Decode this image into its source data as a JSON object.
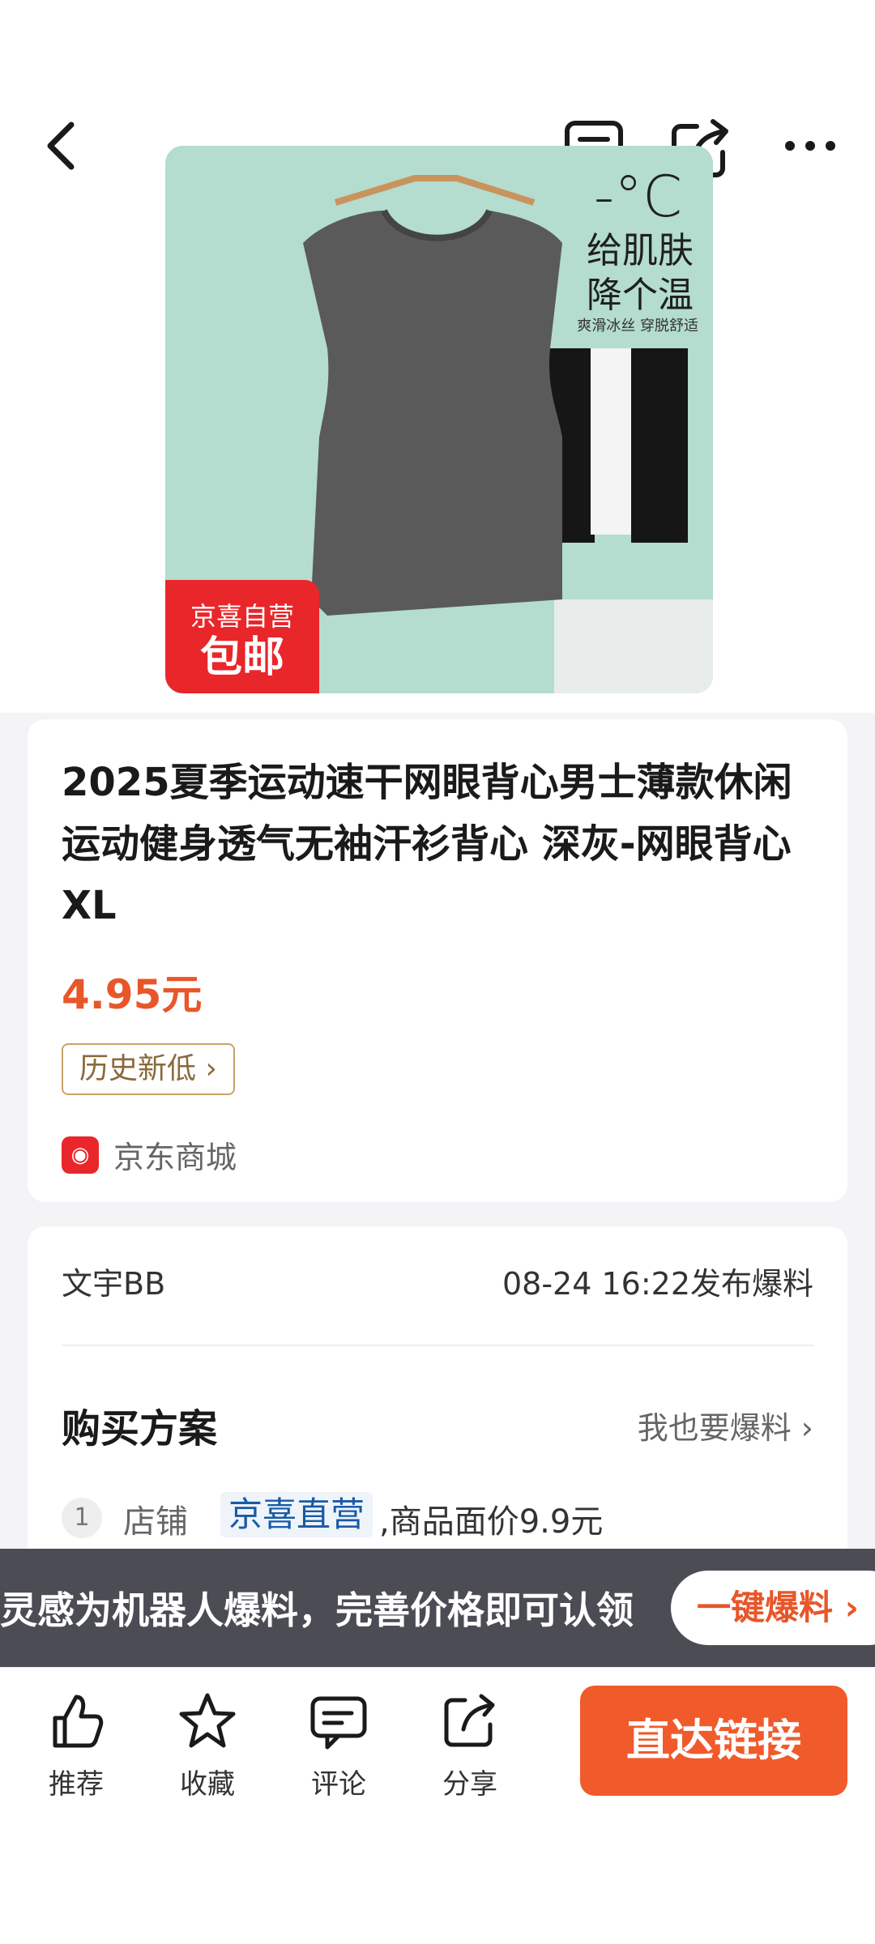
{
  "nav": {
    "back_icon": "back-arrow-icon",
    "comment_icon": "comment-icon",
    "share_icon": "share-icon",
    "more_icon": "more-icon"
  },
  "product_image": {
    "temperature": "-°C",
    "promo_line1": "给肌肤",
    "promo_line2": "降个温",
    "promo_sub": "爽滑冰丝 穿脱舒适",
    "badge_top": "京喜自营",
    "badge_bottom": "包邮"
  },
  "product": {
    "title": "2025夏季运动速干网眼背心男士薄款休闲运动健身透气无袖汗衫背心 深灰-网眼背心 XL",
    "price": "4.95元",
    "tag": "历史新低 ›",
    "mall_name": "京东商城"
  },
  "post": {
    "author": "文宇BB",
    "time": "08-24 16:22发布爆料",
    "plan_title": "购买方案",
    "plan_more": "我也要爆料 ›",
    "step_number": "1",
    "step_label": "店铺",
    "step_store": "京喜直营",
    "step_rest": ",商品面价9.9元"
  },
  "banner": {
    "text": "灵感为机器人爆料，完善价格即可认领",
    "button": "一键爆料 ›"
  },
  "bottom_bar": {
    "items": [
      {
        "label": "推荐",
        "icon": "thumbs-up-icon"
      },
      {
        "label": "收藏",
        "icon": "star-icon"
      },
      {
        "label": "评论",
        "icon": "comment-icon"
      },
      {
        "label": "分享",
        "icon": "share-icon"
      }
    ],
    "cta": "直达链接"
  },
  "colors": {
    "accent": "#f15a2b",
    "price": "#e8562a",
    "badge_red": "#e9262a",
    "banner_bg": "#4b4c54"
  }
}
